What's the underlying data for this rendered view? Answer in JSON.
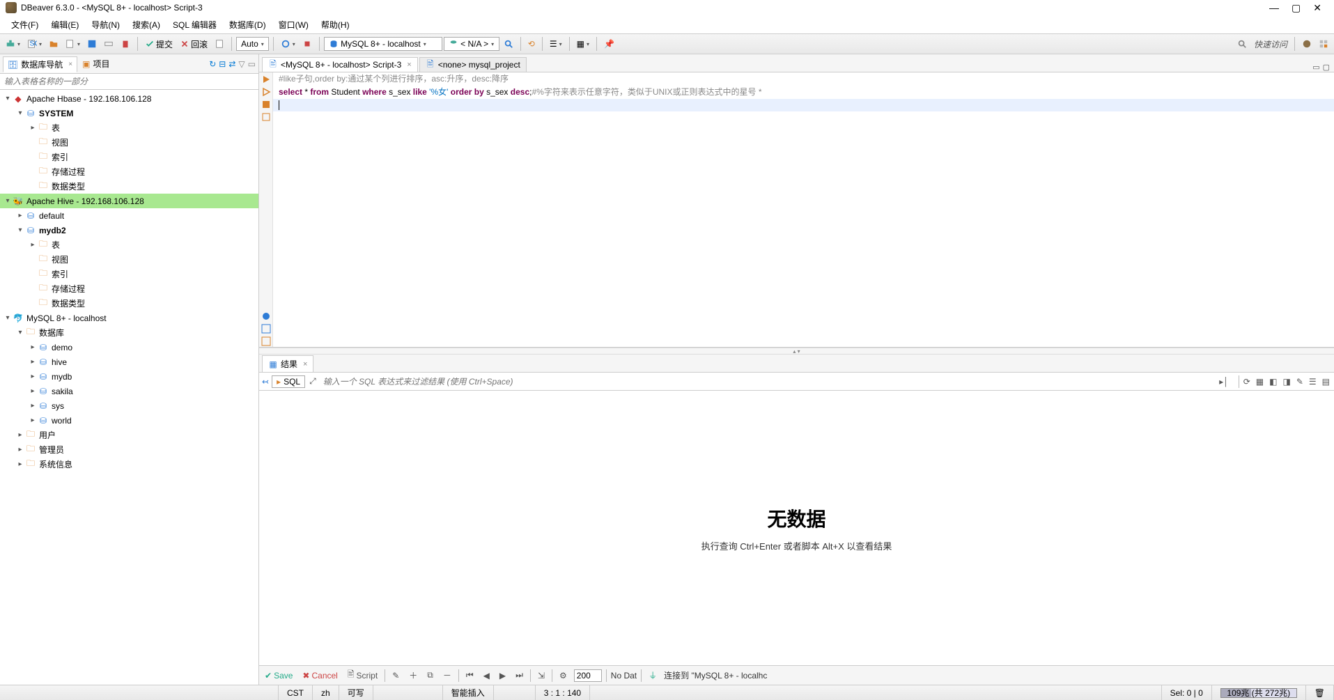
{
  "titlebar": {
    "title": "DBeaver 6.3.0 - <MySQL 8+ - localhost> Script-3"
  },
  "menubar": {
    "items": [
      "文件(F)",
      "编辑(E)",
      "导航(N)",
      "搜索(A)",
      "SQL 编辑器",
      "数据库(D)",
      "窗口(W)",
      "帮助(H)"
    ]
  },
  "toolbar": {
    "commit": "提交",
    "rollback": "回滚",
    "auto": "Auto",
    "connection": "MySQL 8+ - localhost",
    "database": "< N/A >",
    "quick_access": "快速访问"
  },
  "sidebar": {
    "tabs": {
      "nav": "数据库导航",
      "project": "项目"
    },
    "search_placeholder": "输入表格名称的一部分",
    "tree": {
      "hbase": {
        "label": "Apache Hbase - 192.168.106.128",
        "system": "SYSTEM",
        "items": [
          "表",
          "视图",
          "索引",
          "存储过程",
          "数据类型"
        ]
      },
      "hive": {
        "label": "Apache Hive - 192.168.106.128",
        "default": "default",
        "mydb2": "mydb2",
        "items": [
          "表",
          "视图",
          "索引",
          "存储过程",
          "数据类型"
        ]
      },
      "mysql": {
        "label": "MySQL 8+ - localhost",
        "databases": "数据库",
        "dbs": [
          "demo",
          "hive",
          "mydb",
          "sakila",
          "sys",
          "world"
        ],
        "users": "用户",
        "admin": "管理员",
        "sysinfo": "系统信息"
      }
    }
  },
  "editor": {
    "tabs": {
      "script": "<MySQL 8+ - localhost> Script-3",
      "project": "<none> mysql_project"
    },
    "code": {
      "line1_comment": "#like子句,order by:通过某个列进行排序，asc:升序，desc:降序",
      "line2": {
        "select": "select",
        "star": " * ",
        "from": "from",
        "student": " Student ",
        "where": "where",
        "cond1": " s_sex ",
        "like": "like",
        "str": " '%女' ",
        "orderby": "order by",
        "cond2": " s_sex ",
        "desc": "desc",
        "semi": ";",
        "tail_comment": "#%字符来表示任意字符，类似于UNIX或正则表达式中的星号 *"
      }
    }
  },
  "results": {
    "tab": "结果",
    "sql_btn": "SQL",
    "filter_placeholder": "输入一个 SQL 表达式来过滤结果 (使用 Ctrl+Space)",
    "no_data_title": "无数据",
    "no_data_sub": "执行查询 Ctrl+Enter 或者脚本 Alt+X 以查看结果",
    "footer": {
      "save": "Save",
      "cancel": "Cancel",
      "script": "Script",
      "page_size": "200",
      "no_data": "No Dat",
      "connected": "连接到 \"MySQL 8+ - localhc"
    }
  },
  "statusbar": {
    "tz": "CST",
    "locale": "zh",
    "rw": "可写",
    "insert": "智能插入",
    "pos": "3 : 1 : 140",
    "sel": "Sel: 0 | 0",
    "mem": "109兆 (共 272兆)"
  }
}
